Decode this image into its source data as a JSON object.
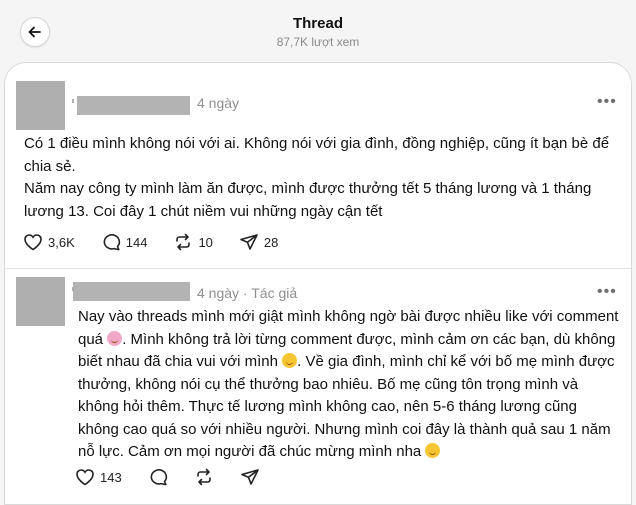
{
  "header": {
    "title": "Thread",
    "views": "87,7K lượt xem"
  },
  "posts": [
    {
      "time": "4 ngày",
      "author_tag": "",
      "text": "Có 1 điều mình không nói với ai. Không nói với gia đình, đồng nghiệp, cũng ít bạn bè để\nchia sẻ.\nNăm nay công ty mình làm ăn được, mình được thưởng tết 5 tháng lương và 1 tháng\nlương 13. Coi đây 1 chút niềm vui những ngày cận tết",
      "likes": "3,6K",
      "comments": "144",
      "reposts": "10",
      "shares": "28"
    },
    {
      "time": "4 ngày",
      "author_tag": "Tác giả",
      "text_lines": [
        "Nay vào threads mình mới giật mình không ngờ bài được nhiều like với comment",
        "quá",
        ". Mình không trả lời từng comment được, mình cảm ơn các bạn, dù không",
        "biết nhau đã chia vui với mình",
        ". Về gia đình, mình chỉ kể với bố mẹ mình được",
        "thưởng, không nói cụ thể thưởng bao nhiêu. Bố mẹ cũng tôn trọng mình và",
        "không hỏi thêm. Thực tế lương mình không cao, nên 5-6 tháng lương cũng",
        "không cao quá so với nhiều người. Nhưng mình coi đây là thành quả sau 1 năm",
        "nỗ lực. Cảm ơn mọi người đã chúc mừng mình nha"
      ],
      "likes": "143"
    }
  ],
  "icons": {
    "back": "arrow-left-icon",
    "more": "more-horizontal-icon",
    "like": "heart-icon",
    "comment": "comment-bubble-icon",
    "repost": "repost-icon",
    "share": "send-icon"
  }
}
